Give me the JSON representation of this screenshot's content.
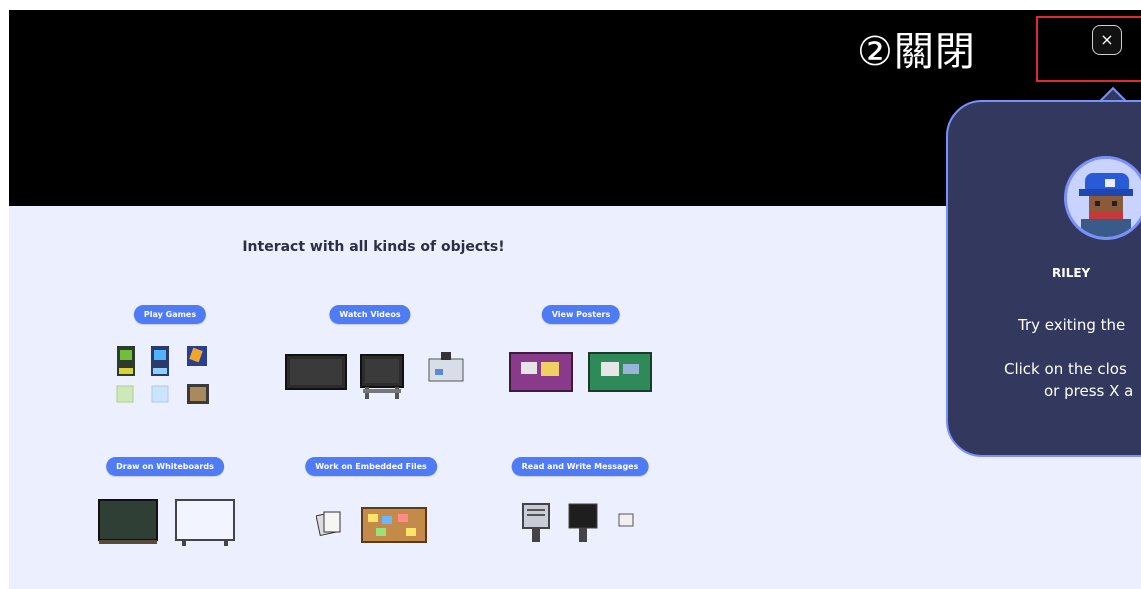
{
  "annotation": {
    "text": "②關閉"
  },
  "close_button": {
    "label": "×"
  },
  "panel": {
    "title": "Interact with all kinds of objects!",
    "categories": [
      "Play Games",
      "Watch Videos",
      "View Posters",
      "Draw on Whiteboards",
      "Work on Embedded Files",
      "Read and Write Messages"
    ]
  },
  "tooltip": {
    "name": "RILEY",
    "line1": "Try exiting the",
    "line2": "Click on the clos",
    "line3": "or press X a"
  },
  "colors": {
    "pill": "#4f7cf5",
    "panel_bg": "#eceffd",
    "tooltip_bg": "#33395e",
    "tooltip_border": "#7990ff",
    "annotation_box": "#e02a2a"
  }
}
